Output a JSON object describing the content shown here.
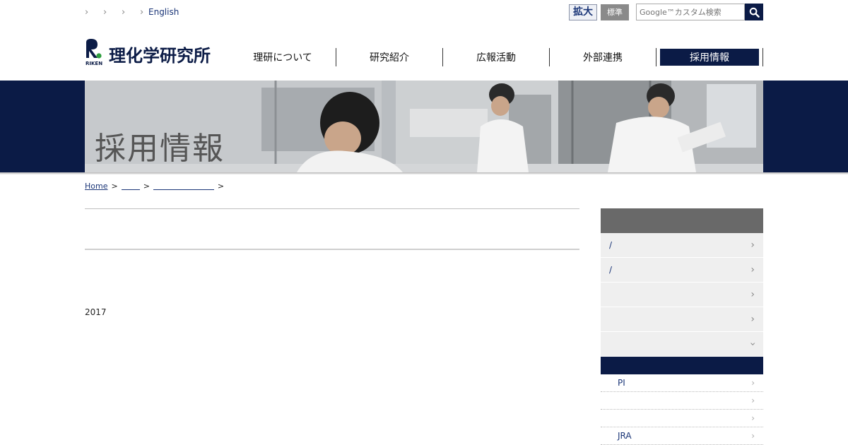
{
  "utility": {
    "links": [
      "",
      "",
      "",
      "English"
    ],
    "size_large": "拡大",
    "size_standard": "標準",
    "search_placeholder": "Google™カスタム検索"
  },
  "logo": {
    "name": "理化学研究所",
    "mark_text": "RIKEN"
  },
  "nav": [
    {
      "label": "理研について"
    },
    {
      "label": "研究紹介"
    },
    {
      "label": "広報活動"
    },
    {
      "label": "外部連携"
    },
    {
      "label": "採用情報",
      "active": true
    }
  ],
  "hero": {
    "title": "採用情報"
  },
  "breadcrumb": {
    "home": "Home",
    "sep": ">"
  },
  "main": {
    "year_text": "2017"
  },
  "sidebar": {
    "items": [
      {
        "label": "/"
      },
      {
        "label": "/"
      },
      {
        "label": ""
      },
      {
        "label": ""
      },
      {
        "label": ""
      }
    ],
    "subitems": [
      {
        "label": "PI"
      },
      {
        "label": ""
      },
      {
        "label": ""
      },
      {
        "label": "JRA"
      }
    ]
  },
  "colors": {
    "navy": "#0b1b46",
    "link": "#1a3577",
    "gray_head": "#696969"
  }
}
